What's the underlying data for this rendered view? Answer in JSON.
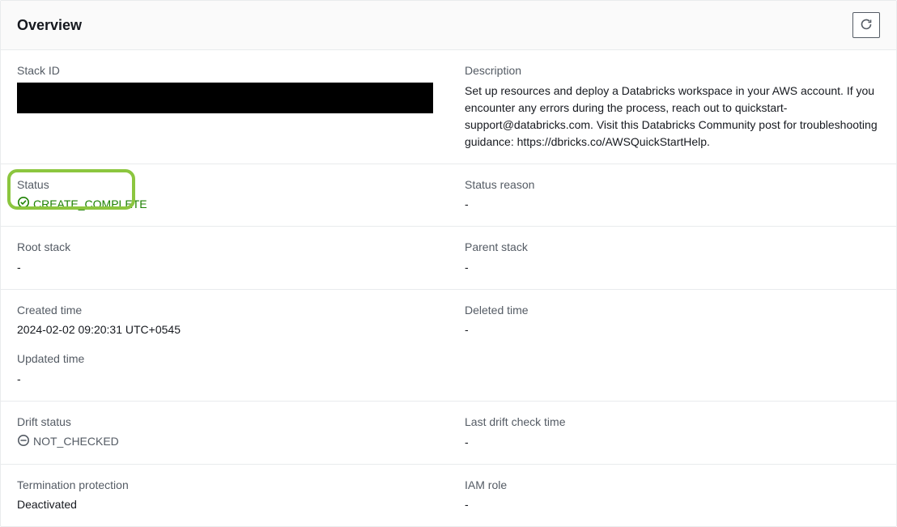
{
  "header": {
    "title": "Overview"
  },
  "fields": {
    "stack_id": {
      "label": "Stack ID",
      "value": ""
    },
    "description": {
      "label": "Description",
      "value": "Set up resources and deploy a Databricks workspace in your AWS account. If you encounter any errors during the process, reach out to quickstart-support@databricks.com. Visit this Databricks Community post for troubleshooting guidance: https://dbricks.co/AWSQuickStartHelp."
    },
    "status": {
      "label": "Status",
      "value": "CREATE_COMPLETE"
    },
    "status_reason": {
      "label": "Status reason",
      "value": "-"
    },
    "root_stack": {
      "label": "Root stack",
      "value": "-"
    },
    "parent_stack": {
      "label": "Parent stack",
      "value": "-"
    },
    "created_time": {
      "label": "Created time",
      "value": "2024-02-02 09:20:31 UTC+0545"
    },
    "deleted_time": {
      "label": "Deleted time",
      "value": "-"
    },
    "updated_time": {
      "label": "Updated time",
      "value": "-"
    },
    "drift_status": {
      "label": "Drift status",
      "value": "NOT_CHECKED"
    },
    "last_drift_check_time": {
      "label": "Last drift check time",
      "value": "-"
    },
    "termination_protection": {
      "label": "Termination protection",
      "value": "Deactivated"
    },
    "iam_role": {
      "label": "IAM role",
      "value": "-"
    }
  },
  "colors": {
    "success": "#1d8102",
    "highlight_ring": "#8cc63f"
  }
}
